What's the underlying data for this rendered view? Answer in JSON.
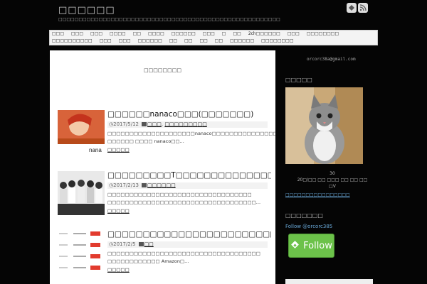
{
  "site": {
    "title": "□□□□□□",
    "description": "□□□□□□□□□□□□□□□□□□□□□□□□□□□□□□□□□□□□□□□□□□□□□□□□□□□□□□□"
  },
  "header_icons": [
    "feedly-icon",
    "rss-icon"
  ],
  "nav": {
    "items": [
      "□□□",
      "□□□",
      "□□□",
      "□□□□",
      "□□",
      "□□□□",
      "□□□□□□",
      "□□□",
      "□",
      "□□",
      "2ch□□□□□□",
      "□□□",
      "□□□□□□□□",
      "□□□□□□□□□□",
      "□□□",
      "□□□",
      "□□□□□□",
      "□□",
      "□□",
      "□□",
      "□□",
      "□□□□□□",
      "□□□□□□□□"
    ]
  },
  "main": {
    "heading": "□□□□□□□□",
    "posts": [
      {
        "title": "□□□□□□nanaco□□□(□□□□□□□)",
        "date": "2017/5/12",
        "categories": [
          "□□□",
          "□□□□□□□□□"
        ],
        "excerpt": "□□□□□□□□□□□□□□□□□□□□nanaco□□□□□□□□□□□□□□□ □□□□□□ □□□□ nanaco□□...",
        "more": "□□□□□"
      },
      {
        "title": "□□□□□□□□□T□□□□□□□□□□□□□□",
        "date": "2017/2/13",
        "categories": [
          "□□□□□□"
        ],
        "excerpt": "□□□□□□□□□□□□□□□□□□□□□□□□□□□□□□□□□ □□□□□□□□□□□□□□□□□□□□□□□□□□□□□□□□□□...",
        "more": "□□□□□"
      },
      {
        "title": "□□□□□□□□□□□□□□□□□□□□□□□□□□□",
        "date": "2017/2/5",
        "categories": [
          "□□"
        ],
        "excerpt": "□□□□□□□□□□□□□□□□□□□□□□□□□□□□□□□□□□□ □□□□□□□□□□□□ Amazon□...",
        "more": "□□□□□"
      }
    ]
  },
  "sidebar": {
    "email": "orcorc38a@gmail.com",
    "profile_heading": "□□□□□",
    "caption_line1": "30",
    "caption_line2": "20□/□□ □□ □□□ □□ □□ □□ □V",
    "link": "□□□□□□□□□□□□□□□□",
    "follow_heading": "□□□□□□□",
    "follow_handle": "Follow @orcorc385",
    "follow_button": "Follow"
  },
  "colors": {
    "background": "#050505",
    "nav_bg": "#f4f4f4",
    "link": "#6aa9d9",
    "follow_green": "#6cc24a"
  }
}
